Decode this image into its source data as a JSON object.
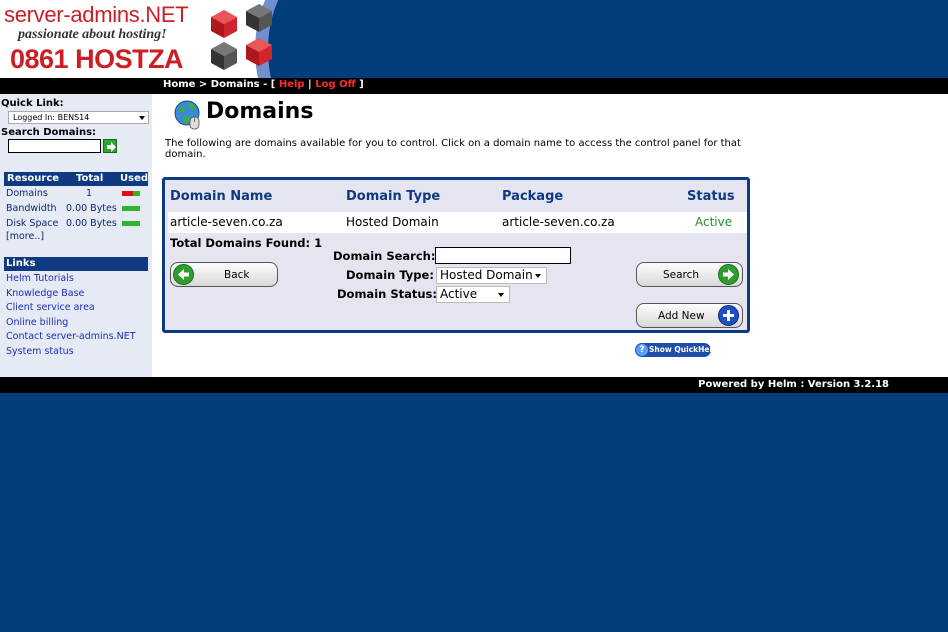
{
  "header": {
    "logo_line1": "server-admins.NET",
    "logo_line2": "passionate about hosting!",
    "logo_line3": "0861 HOSTZA",
    "brand_red": "#cc1f24",
    "brand_blue": "#003d7a"
  },
  "navbar": {
    "home": "Home",
    "sep1": " > ",
    "current": "Domains",
    "sep2": " - [ ",
    "help": "Help",
    "sep3": " | ",
    "logoff": "Log Off",
    "sep4": " ]"
  },
  "sidebar": {
    "quick_link_label": "Quick Link:",
    "quick_link_value": "Logged In: BENS14",
    "search_label": "Search Domains:",
    "resource_headers": [
      "Resource",
      "Total",
      "Used"
    ],
    "resources": [
      {
        "name": "Domains",
        "total": "1"
      },
      {
        "name": "Bandwidth",
        "total": "0.00 Bytes"
      },
      {
        "name": "Disk Space",
        "total": "0.00 Bytes"
      }
    ],
    "more": "[more..]",
    "links_label": "Links",
    "links": [
      "Helm Tutorials",
      "Knowledge Base",
      "Client service area",
      "Online billing",
      "Contact server-admins.NET",
      "System status"
    ]
  },
  "main": {
    "title": "Domains",
    "intro": "The following are domains available for you to control. Click on a domain name to access the control panel for that domain.",
    "columns": [
      "Domain Name",
      "Domain Type",
      "Package",
      "Status"
    ],
    "rows": [
      {
        "domain": "article-seven.co.za",
        "type": "Hosted Domain",
        "package": "article-seven.co.za",
        "status": "Active"
      }
    ],
    "total_found": "Total Domains Found: 1",
    "form": {
      "domain_search_label": "Domain Search:",
      "domain_search_value": "",
      "domain_type_label": "Domain Type:",
      "domain_type_value": "Hosted Domain",
      "domain_status_label": "Domain Status:",
      "domain_status_value": "Active"
    },
    "buttons": {
      "back": "Back",
      "search": "Search",
      "add_new": "Add New"
    },
    "quickhelp": "Show QuickHelp"
  },
  "footer": {
    "powered": "Powered by Helm  :  Version 3.2.18"
  }
}
